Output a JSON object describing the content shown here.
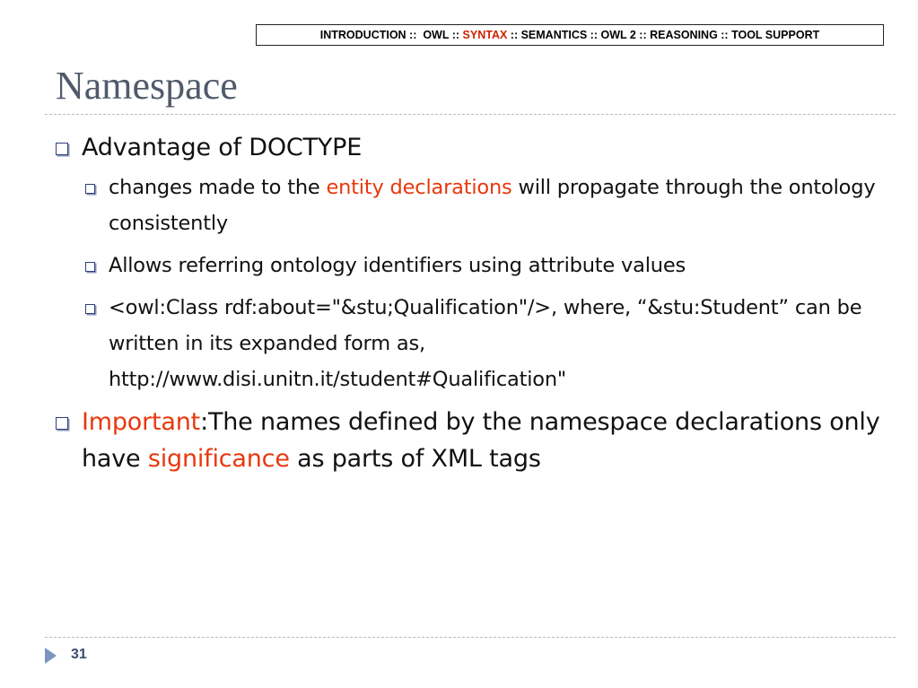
{
  "nav": {
    "before": "INTRODUCTION ::  OWL :: ",
    "active": "SYNTAX",
    "after": " :: SEMANTICS :: OWL 2 :: REASONING :: TOOL SUPPORT"
  },
  "slide": {
    "title": "Namespace",
    "bullet1": {
      "text": "Advantage of DOCTYPE",
      "sub1": {
        "before": "changes made to the ",
        "highlight": "entity declarations",
        "after": " will propagate through the ontology consistently"
      },
      "sub2": "Allows referring ontology identifiers using attribute values",
      "sub3": "<owl:Class rdf:about=\"&stu;Qualification\"/>, where, “&stu:Student” can be written in its expanded form as, http://www.disi.unitn.it/student#Qualification\""
    },
    "bullet2": {
      "highlight1": "Important",
      "mid": ":The names defined by the namespace declarations only have ",
      "highlight2": "significance",
      "after": " as parts of XML tags"
    }
  },
  "footer": {
    "page_number": "31",
    "arrow_icon": "triangle-right-icon"
  },
  "colors": {
    "accent": "#e8380d",
    "title": "#505a6a",
    "bullet": "#2f3e80"
  }
}
